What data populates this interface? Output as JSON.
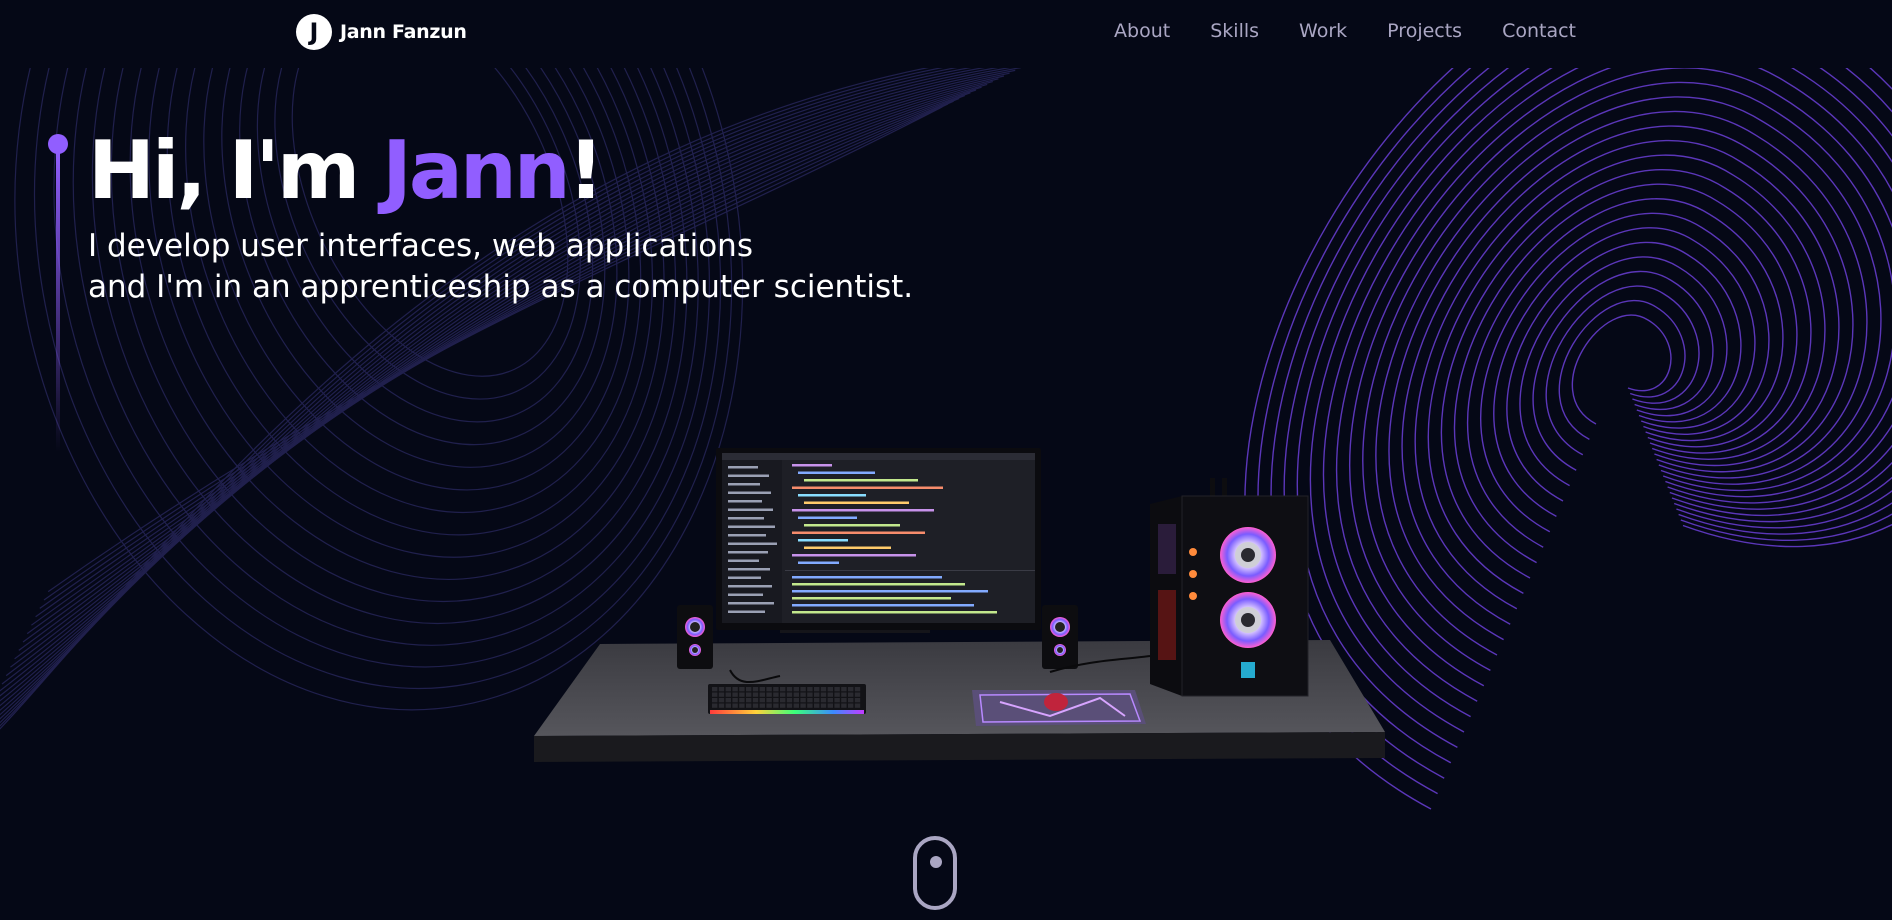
{
  "nav": {
    "logo_letter": "J",
    "brand": "Jann Fanzun",
    "links": [
      "About",
      "Skills",
      "Work",
      "Projects",
      "Contact"
    ]
  },
  "hero": {
    "greeting": "Hi, I'm ",
    "name": "Jann",
    "exclaim": "!",
    "subtitle_line1": "I develop user interfaces, web applications",
    "subtitle_line2": "and I'm in an apprenticeship as a computer scientist."
  },
  "colors": {
    "background": "#050816",
    "accent": "#915eff",
    "nav_text": "#aaa6c3",
    "white": "#ffffff"
  },
  "icons": {
    "logo": "j-logo-icon",
    "scroll": "mouse-scroll-icon"
  }
}
